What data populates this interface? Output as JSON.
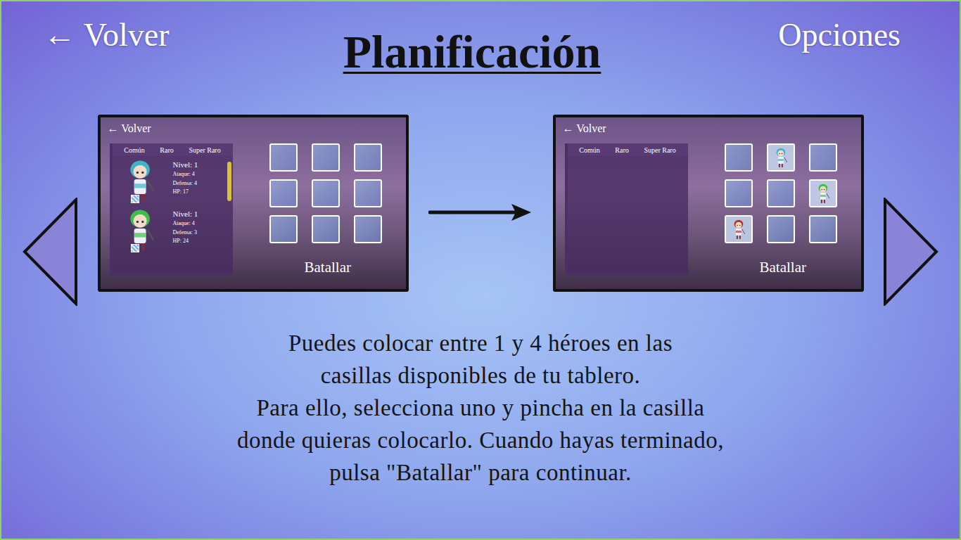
{
  "nav": {
    "back": "← Volver",
    "options": "Opciones"
  },
  "title": "Planificación",
  "screens": [
    {
      "back": "← Volver",
      "tabs": [
        "Común",
        "Raro",
        "Super Raro"
      ],
      "scrollbar": true,
      "heroes": [
        {
          "level": "Nivel: 1",
          "attack": "Ataque: 4",
          "defense": "Defensa: 4",
          "hp": "HP: 17",
          "color": "#3fb6c8"
        },
        {
          "level": "Nivel: 1",
          "attack": "Ataque: 4",
          "defense": "Defensa: 3",
          "hp": "HP: 24",
          "color": "#3fbf4a"
        }
      ],
      "cells": [
        {
          "occupied": false
        },
        {
          "occupied": false
        },
        {
          "occupied": false
        },
        {
          "occupied": false
        },
        {
          "occupied": false
        },
        {
          "occupied": false
        },
        {
          "occupied": false
        },
        {
          "occupied": false
        },
        {
          "occupied": false
        }
      ],
      "action": "Batallar"
    },
    {
      "back": "← Volver",
      "tabs": [
        "Común",
        "Raro",
        "Super Raro"
      ],
      "scrollbar": false,
      "heroes": [],
      "cells": [
        {
          "occupied": false
        },
        {
          "occupied": true,
          "color": "#3fb6c8"
        },
        {
          "occupied": false
        },
        {
          "occupied": false
        },
        {
          "occupied": false
        },
        {
          "occupied": true,
          "color": "#3fbf4a"
        },
        {
          "occupied": true,
          "color": "#b8322e"
        },
        {
          "occupied": false
        },
        {
          "occupied": false
        }
      ],
      "action": "Batallar"
    }
  ],
  "description": [
    "Puedes colocar entre 1 y 4 héroes en las",
    "casillas disponibles de tu tablero.",
    "Para ello, selecciona uno y pincha en la casilla",
    "donde quieras colocarlo. Cuando hayas terminado,",
    "pulsa \"Batallar\" para continuar."
  ]
}
